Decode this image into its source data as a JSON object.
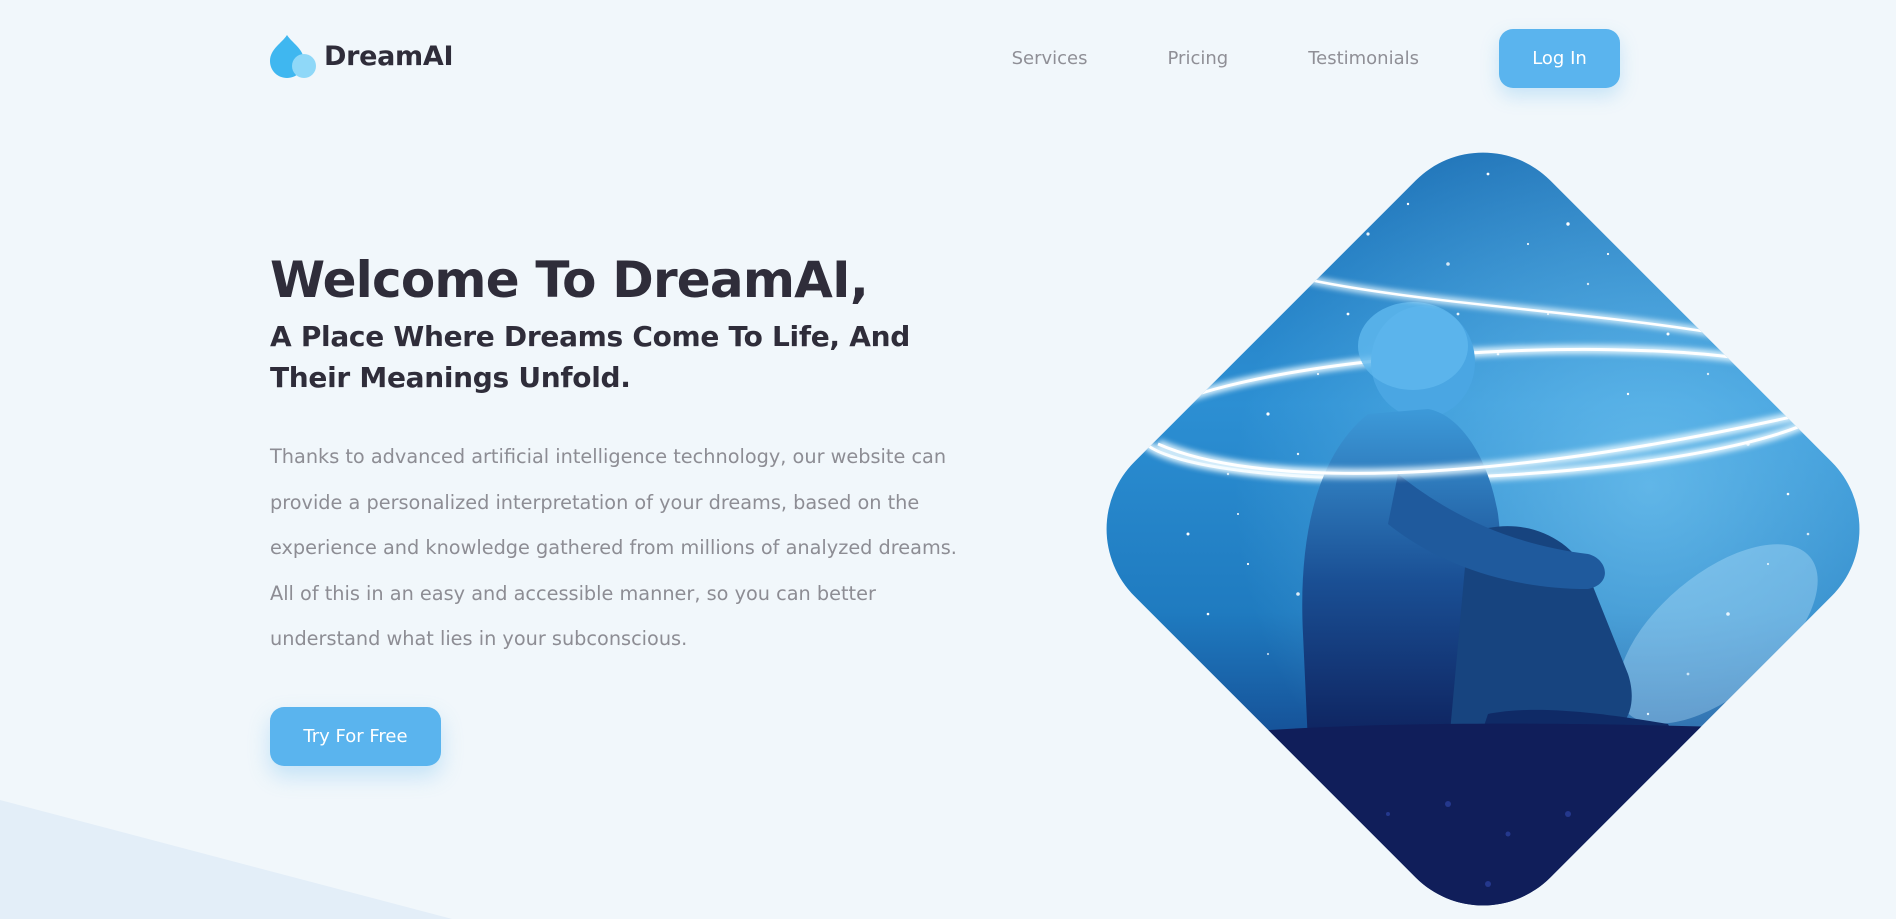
{
  "brand": {
    "name": "DreamAI"
  },
  "nav": {
    "links": [
      {
        "label": "Services"
      },
      {
        "label": "Pricing"
      },
      {
        "label": "Testimonials"
      }
    ],
    "login_label": "Log In"
  },
  "hero": {
    "title": "Welcome To DreamAI,",
    "subtitle": "A Place Where Dreams Come To Life, And Their Meanings Unfold.",
    "body": "Thanks to advanced artificial intelligence technology, our website can provide a personalized interpretation of your dreams, based on the experience and knowledge gathered from millions of analyzed dreams. All of this in an easy and accessible manner, so you can better understand what lies in your subconscious.",
    "cta_label": "Try For Free",
    "image_icon": "starry-sky-person-illustration"
  },
  "colors": {
    "accent": "#5ab4ee",
    "heading": "#2f2d3a",
    "body_text": "#8d8d94",
    "nav_text": "#8f8f96",
    "background": "#f1f7fb",
    "logo_primary": "#3fb7f0",
    "logo_secondary": "#8fd8f8"
  }
}
